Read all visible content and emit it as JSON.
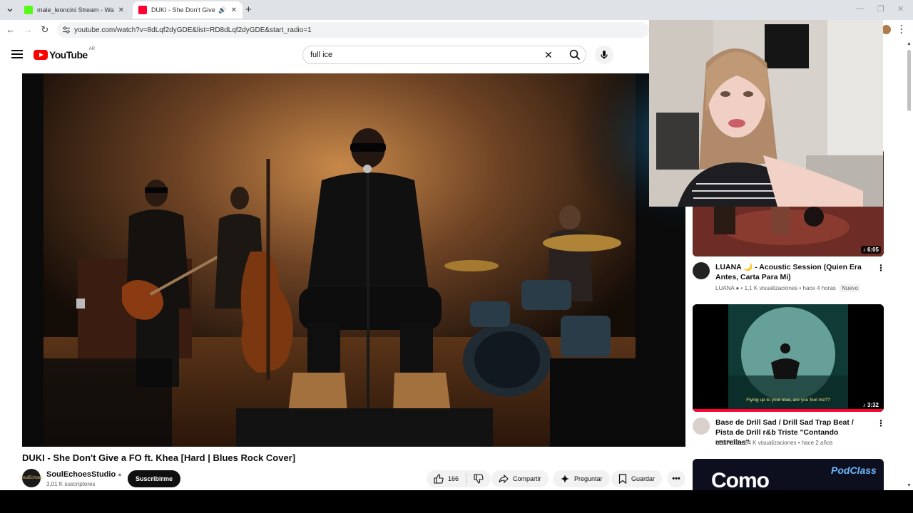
{
  "browser": {
    "tabs": [
      {
        "title": "male_leoncini Stream - Watch L",
        "favicon_color": "#53fc18"
      },
      {
        "title": "DUKI - She Don't Give a FO",
        "favicon_color": "#ff0033"
      }
    ],
    "url": "youtube.com/watch?v=8dLqf2dyGDE&list=RD8dLqf2dyGDE&start_radio=1"
  },
  "youtube": {
    "logo_text": "YouTube",
    "country_code": "AR",
    "search_query": "full ice",
    "video": {
      "title": "DUKI - She Don't Give a FO ft. Khea [Hard | Blues Rock Cover]",
      "channel": "SoulEchoesStudio",
      "channel_avatar_text": "SoulEchoes",
      "subscribers": "3,01 K suscriptores",
      "subscribe_label": "Suscribirme",
      "likes": "166",
      "share_label": "Compartir",
      "ask_label": "Preguntar",
      "save_label": "Guardar"
    },
    "recommendations": [
      {
        "duration": "6:05",
        "title": "LUANA 🌙 - Acoustic Session (Quien Era Antes, Carta Para Mi)",
        "channel": "LUANA",
        "views": "1,1 K visualizaciones",
        "age": "hace 4 horas",
        "badge": "Nuevo"
      },
      {
        "duration": "3:32",
        "subtitle_overlay": "Flying up to your love, are you feel me??",
        "title": "Base de Drill Sad / Drill Sad Trap Beat / Pista de Drill r&b Triste \"Contando estrellas\"",
        "channel": "LESPICE",
        "views": "34 K visualizaciones",
        "age": "hace 2 años"
      },
      {
        "overlay_text_big": "Como",
        "overlay_logo": "PodClass"
      }
    ]
  }
}
